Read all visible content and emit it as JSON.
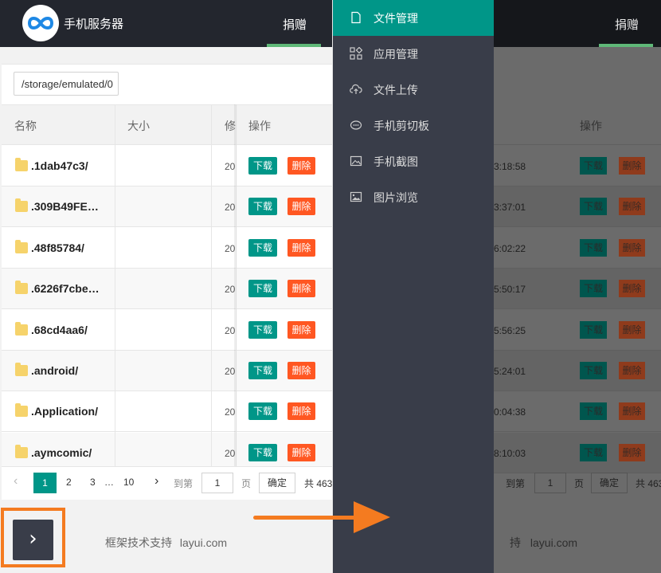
{
  "header": {
    "app_title": "手机服务器",
    "donate": "捐赠",
    "logo_icon": "infinity-icon"
  },
  "path": "/storage/emulated/0",
  "table": {
    "columns": [
      "名称",
      "大小",
      "修",
      "操作"
    ],
    "rows": [
      {
        "name": ".1dab47c3/",
        "date": "20"
      },
      {
        "name": ".309B49FE…",
        "date": "20"
      },
      {
        "name": ".48f85784/",
        "date": "20"
      },
      {
        "name": ".6226f7cbe…",
        "date": "20"
      },
      {
        "name": ".68cd4aa6/",
        "date": "20"
      },
      {
        "name": ".android/",
        "date": "20"
      },
      {
        "name": ".Application/",
        "date": "20"
      },
      {
        "name": ".aymcomic/",
        "date": "20"
      }
    ],
    "download_label": "下载",
    "delete_label": "删除"
  },
  "pagination": {
    "prev": "‹",
    "pages": [
      "1",
      "2",
      "3",
      "…",
      "10"
    ],
    "next": "›",
    "goto_label": "到第",
    "goto_value": "1",
    "page_unit": "页",
    "confirm_label": "确定",
    "total": "共 463"
  },
  "footer": {
    "text": "框架技术支持",
    "link": "layui.com",
    "toggle_symbol": "›"
  },
  "menu": {
    "items": [
      {
        "label": "文件管理",
        "icon": "file-icon",
        "active": true
      },
      {
        "label": "应用管理",
        "icon": "apps-icon"
      },
      {
        "label": "文件上传",
        "icon": "cloud-upload-icon"
      },
      {
        "label": "手机剪切板",
        "icon": "clipboard-icon"
      },
      {
        "label": "手机截图",
        "icon": "screenshot-icon"
      },
      {
        "label": "图片浏览",
        "icon": "image-icon"
      }
    ]
  },
  "right_view": {
    "column_op": "操作",
    "times": [
      "3:18:58",
      "3:37:01",
      "6:02:22",
      "5:50:17",
      "5:56:25",
      "5:24:01",
      "0:04:38",
      "8:10:03"
    ],
    "goto_label": "到第",
    "goto_value": "1",
    "page_unit": "页",
    "confirm_label": "确定",
    "total": "共 463",
    "footer_partial": "持",
    "footer_link": "layui.com"
  },
  "colors": {
    "accent": "#009688",
    "danger": "#ff5722",
    "header": "#23262e",
    "menu": "#393d49",
    "highlight": "#f47b20",
    "donate_bar": "#5fb878"
  }
}
